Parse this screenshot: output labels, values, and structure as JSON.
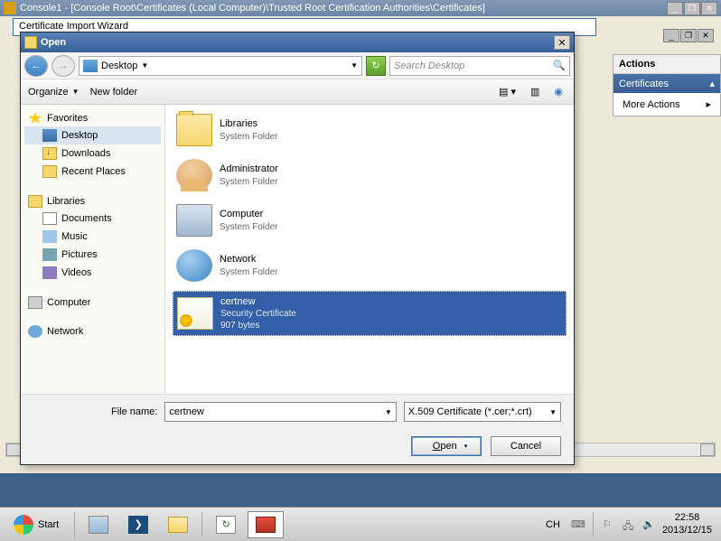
{
  "mmc": {
    "title": "Console1 - [Console Root\\Certificates (Local Computer)\\Trusted Root Certification Authorities\\Certificates]"
  },
  "wizard": {
    "title": "Certificate Import Wizard"
  },
  "actions": {
    "header": "Actions",
    "cert_header": "Certificates",
    "more": "More Actions"
  },
  "dialog": {
    "title": "Open",
    "location": "Desktop",
    "search_placeholder": "Search Desktop",
    "organize": "Organize",
    "new_folder": "New folder",
    "file_name_label": "File name:",
    "file_name_value": "certnew",
    "file_type": "X.509 Certificate (*.cer;*.crt)",
    "open_btn": "Open",
    "cancel_btn": "Cancel"
  },
  "nav": {
    "favorites": "Favorites",
    "desktop": "Desktop",
    "downloads": "Downloads",
    "recent": "Recent Places",
    "libraries": "Libraries",
    "documents": "Documents",
    "music": "Music",
    "pictures": "Pictures",
    "videos": "Videos",
    "computer": "Computer",
    "network": "Network"
  },
  "items": {
    "libraries": {
      "name": "Libraries",
      "sub": "System Folder"
    },
    "admin": {
      "name": "Administrator",
      "sub": "System Folder"
    },
    "computer": {
      "name": "Computer",
      "sub": "System Folder"
    },
    "network": {
      "name": "Network",
      "sub": "System Folder"
    },
    "cert": {
      "name": "certnew",
      "sub": "Security Certificate",
      "size": "907 bytes"
    }
  },
  "taskbar": {
    "start": "Start",
    "lang": "CH",
    "time": "22:58",
    "date": "2013/12/15"
  }
}
